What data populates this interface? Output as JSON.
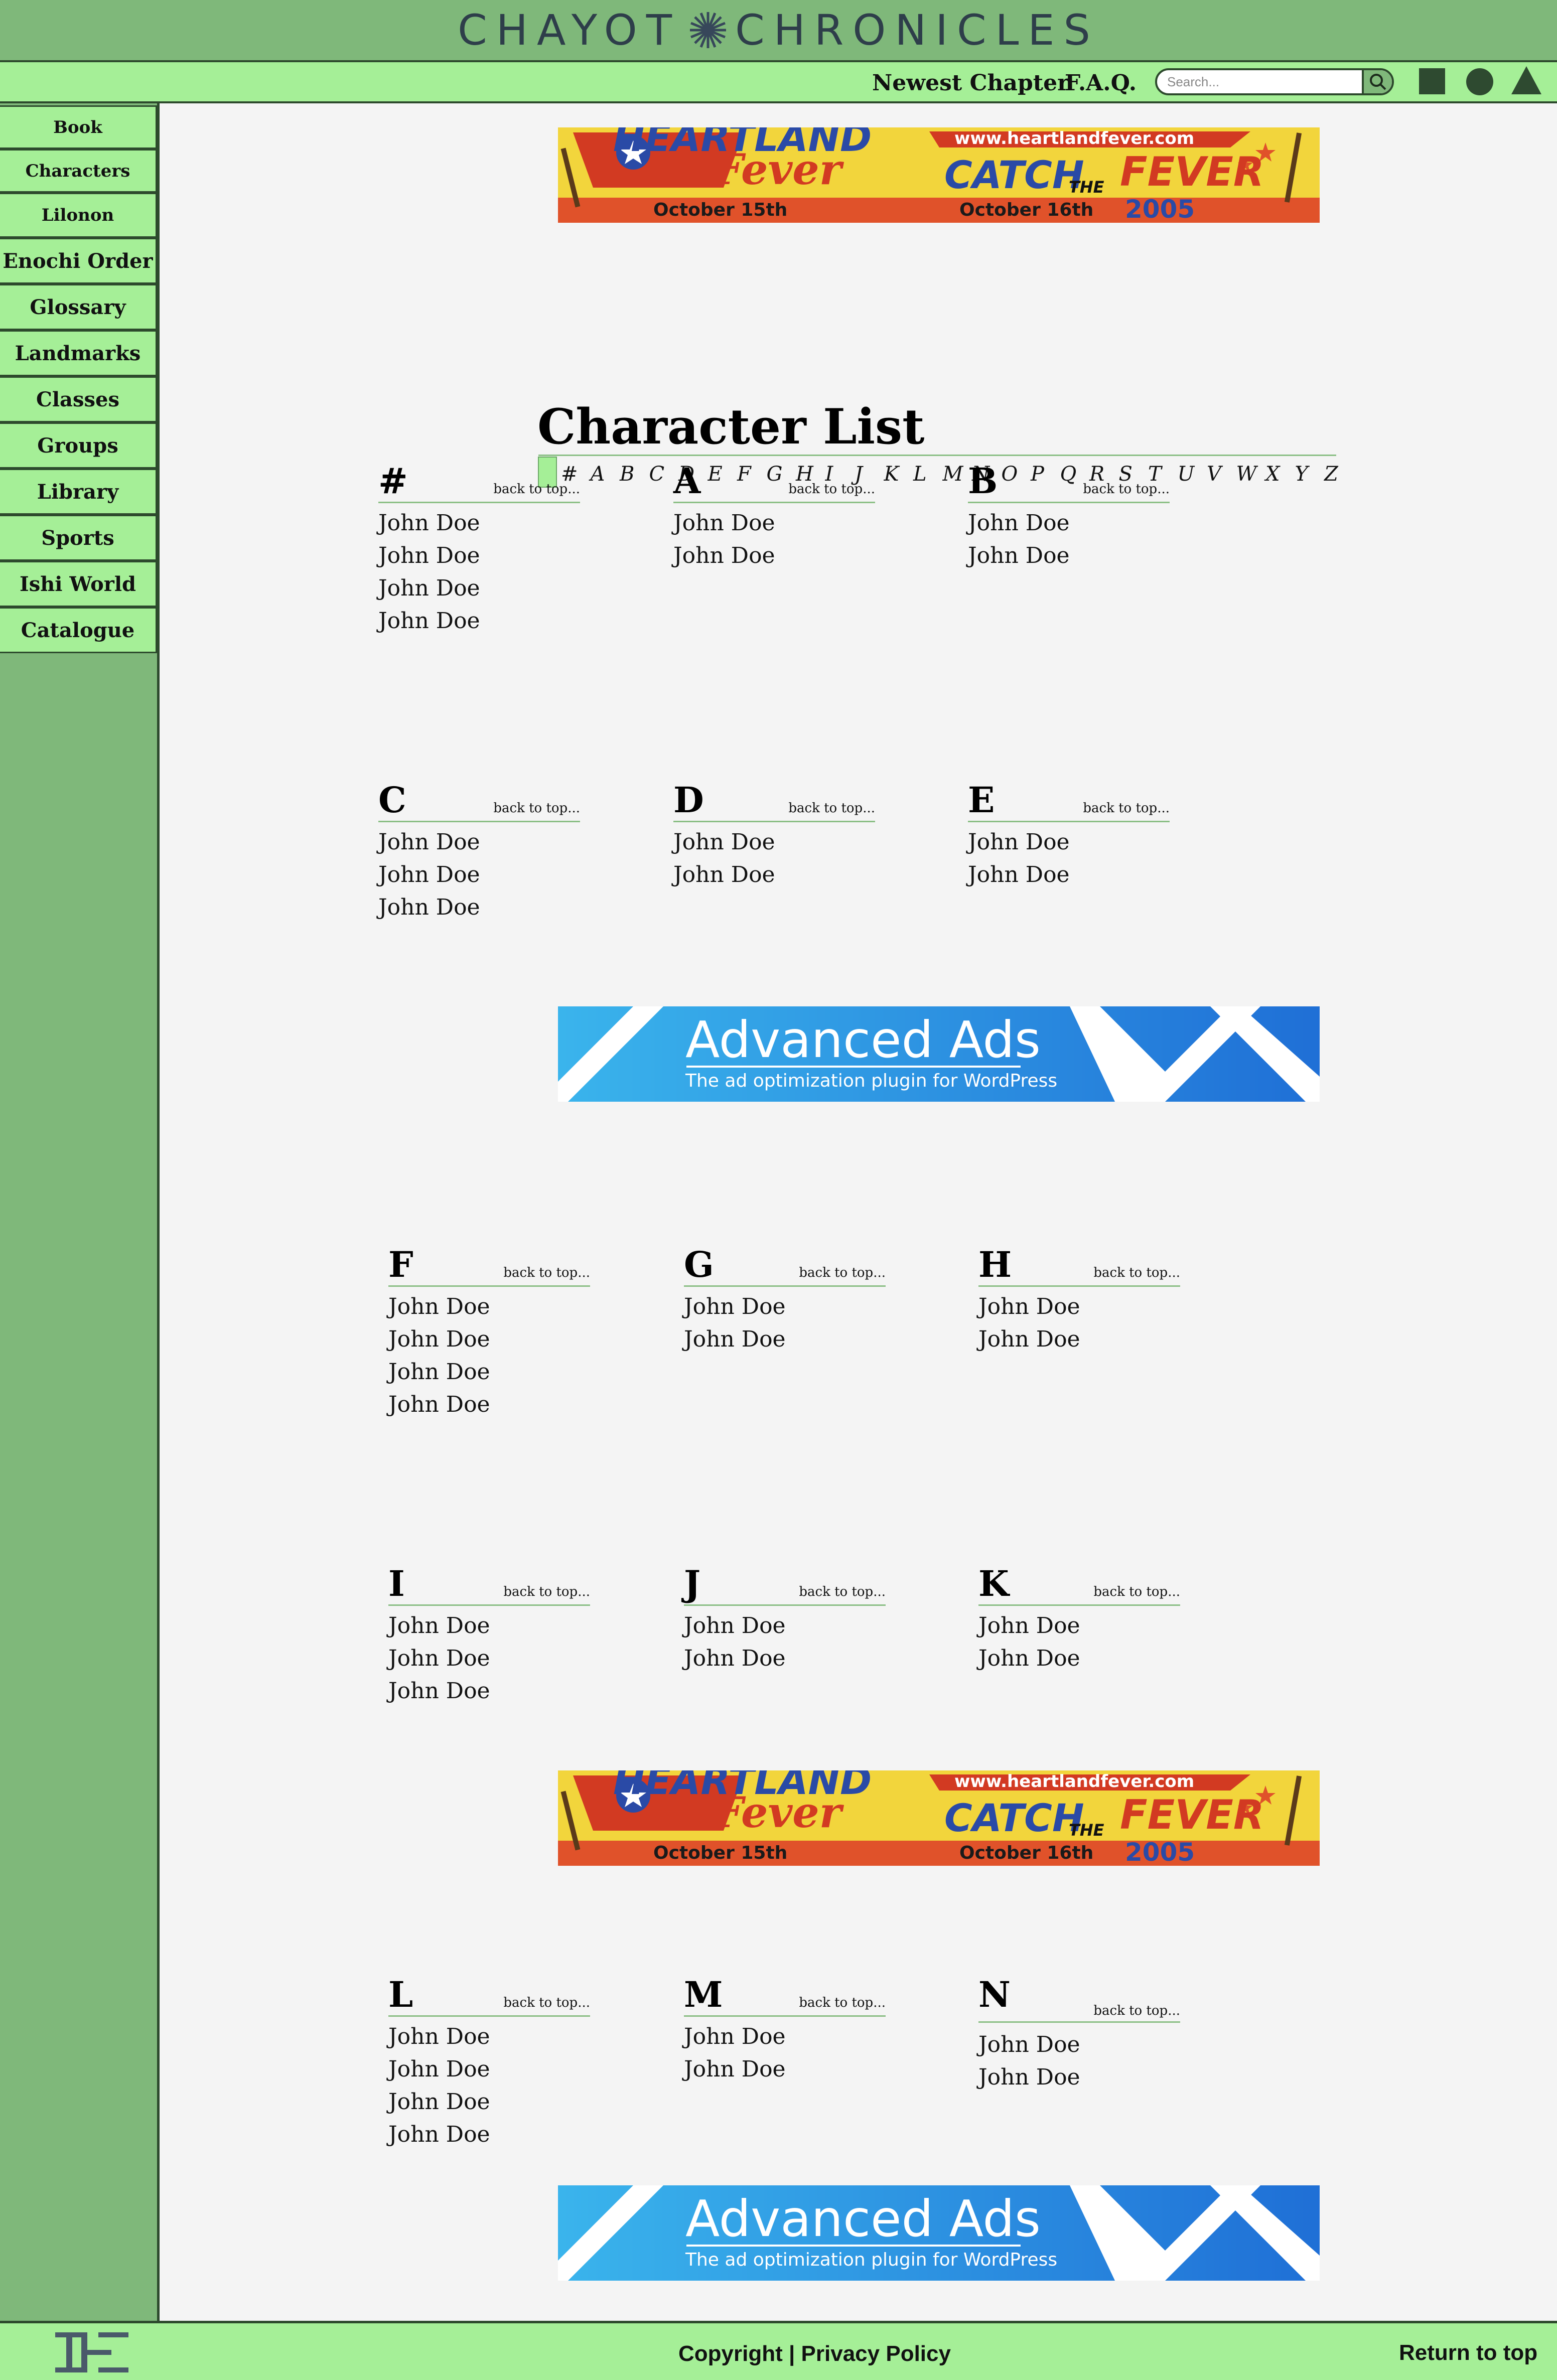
{
  "header": {
    "title_left": "CHAYOT",
    "title_right": "CHRONICLES"
  },
  "nav": {
    "newest_chapter": "Newest Chapter",
    "faq": "F.A.Q.",
    "search_placeholder": "Search..."
  },
  "sidebar": {
    "items": [
      {
        "label": "Book"
      },
      {
        "label": "Characters"
      },
      {
        "label": "Lilonon"
      },
      {
        "label": "Enochi Order"
      },
      {
        "label": "Glossary"
      },
      {
        "label": "Landmarks"
      },
      {
        "label": "Classes"
      },
      {
        "label": "Groups"
      },
      {
        "label": "Library"
      },
      {
        "label": "Sports"
      },
      {
        "label": "Ishi World"
      },
      {
        "label": "Catalogue"
      }
    ]
  },
  "ads": {
    "heartland": {
      "title": "HEARTLAND",
      "subtitle": "Fever",
      "url": "www.heartlandfever.com",
      "catch": "CATCH",
      "the": "THE",
      "fever": "FEVER",
      "date_left": "October 15th",
      "date_right": "October 16th",
      "year": "2005"
    },
    "advanced": {
      "title": "Advanced Ads",
      "tagline": "The ad optimization plugin for WordPress"
    }
  },
  "main": {
    "page_title": "Character List",
    "alphabet": [
      "#",
      "A",
      "B",
      "C",
      "D",
      "E",
      "F",
      "G",
      "H",
      "I",
      "J",
      "K",
      "L",
      "M",
      "N",
      "O",
      "P",
      "Q",
      "R",
      "S",
      "T",
      "U",
      "V",
      "W",
      "X",
      "Y",
      "Z"
    ],
    "back_to_top": "back to top...",
    "sections": [
      {
        "letter": "#",
        "names": [
          "John Doe",
          "John Doe",
          "John Doe",
          "John Doe"
        ]
      },
      {
        "letter": "A",
        "names": [
          "John Doe",
          "John Doe"
        ]
      },
      {
        "letter": "B",
        "names": [
          "John Doe",
          "John Doe"
        ]
      },
      {
        "letter": "C",
        "names": [
          "John Doe",
          "John Doe",
          "John Doe"
        ]
      },
      {
        "letter": "D",
        "names": [
          "John Doe",
          "John Doe"
        ]
      },
      {
        "letter": "E",
        "names": [
          "John Doe",
          "John Doe"
        ]
      },
      {
        "letter": "F",
        "names": [
          "John Doe",
          "John Doe",
          "John Doe",
          "John Doe"
        ]
      },
      {
        "letter": "G",
        "names": [
          "John Doe",
          "John Doe"
        ]
      },
      {
        "letter": "H",
        "names": [
          "John Doe",
          "John Doe"
        ]
      },
      {
        "letter": "I",
        "names": [
          "John Doe",
          "John Doe",
          "John Doe"
        ]
      },
      {
        "letter": "J",
        "names": [
          "John Doe",
          "John Doe"
        ]
      },
      {
        "letter": "K",
        "names": [
          "John Doe",
          "John Doe"
        ]
      },
      {
        "letter": "L",
        "names": [
          "John Doe",
          "John Doe",
          "John Doe",
          "John Doe"
        ]
      },
      {
        "letter": "M",
        "names": [
          "John Doe",
          "John Doe"
        ]
      },
      {
        "letter": "N",
        "names": [
          "John Doe",
          "John Doe"
        ]
      }
    ]
  },
  "footer": {
    "copyright": "Copyright",
    "separator": "|",
    "privacy": "Privacy Policy",
    "return_top": "Return to top"
  }
}
